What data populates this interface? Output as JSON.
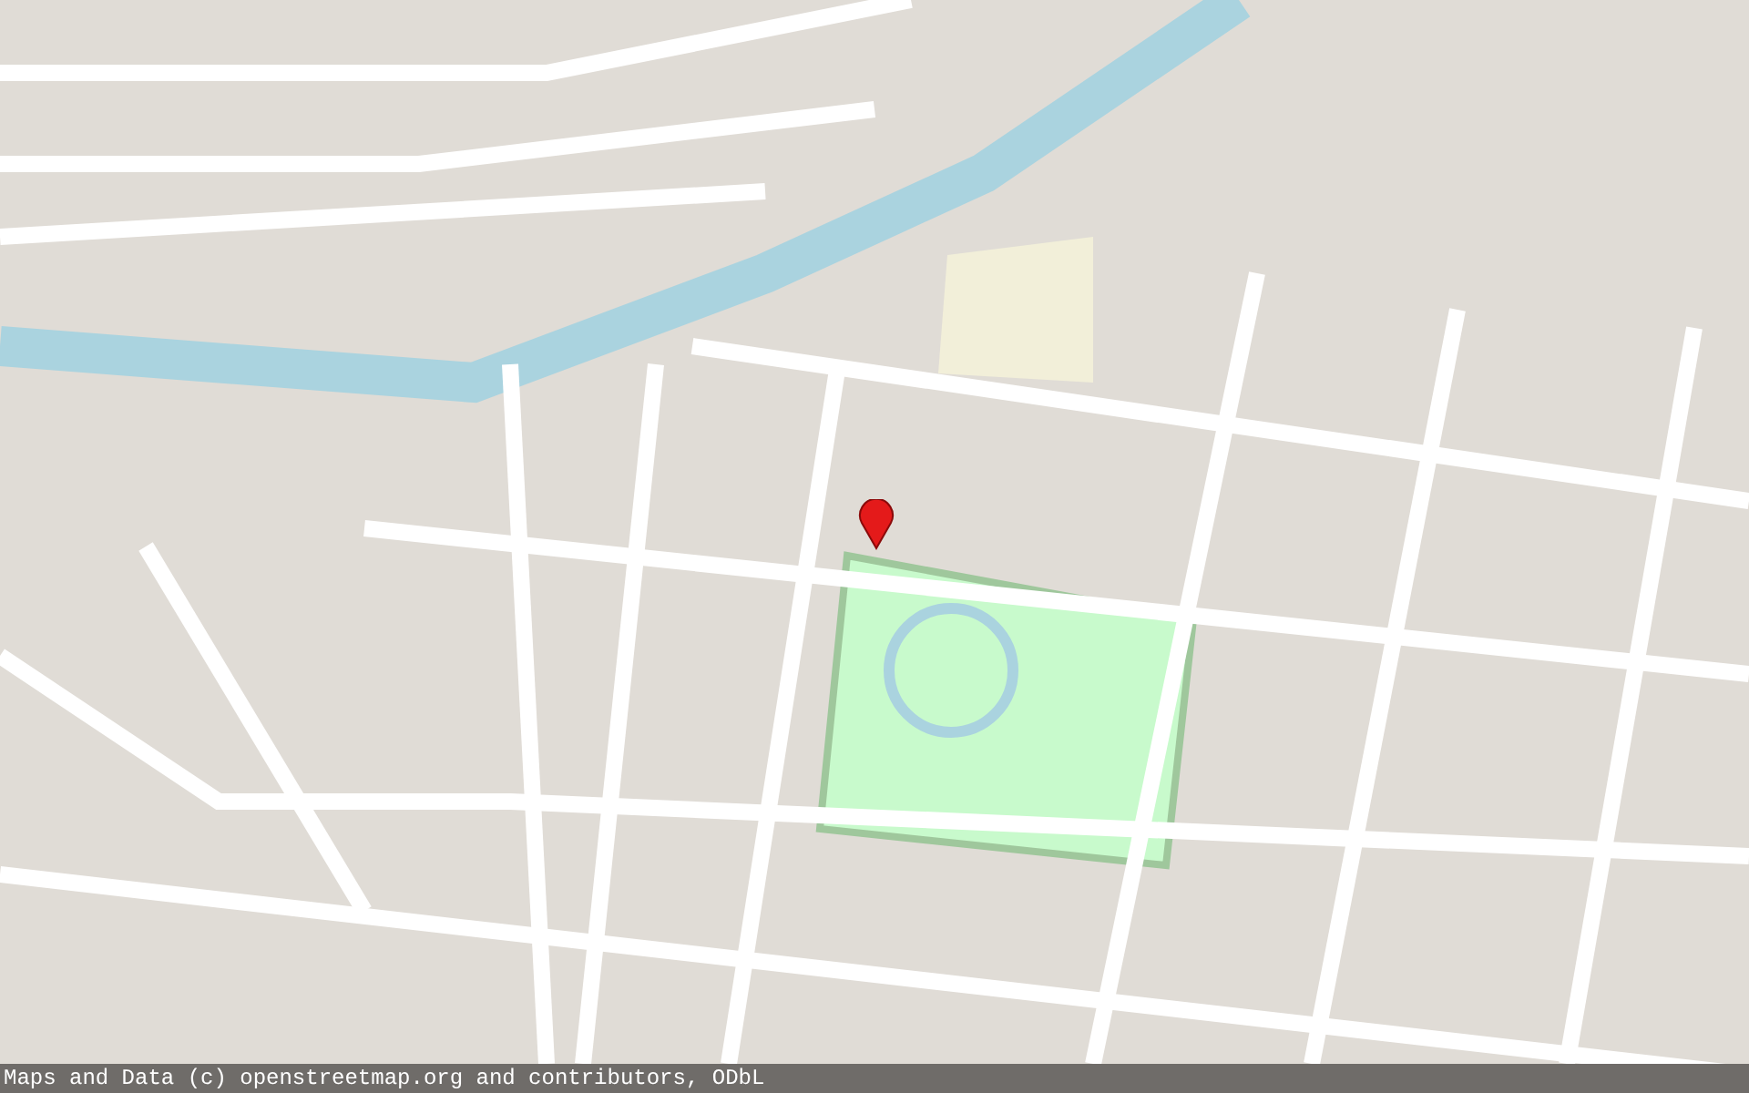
{
  "map": {
    "attribution": "Maps and Data (c) openstreetmap.org and contributors, ODbL"
  }
}
